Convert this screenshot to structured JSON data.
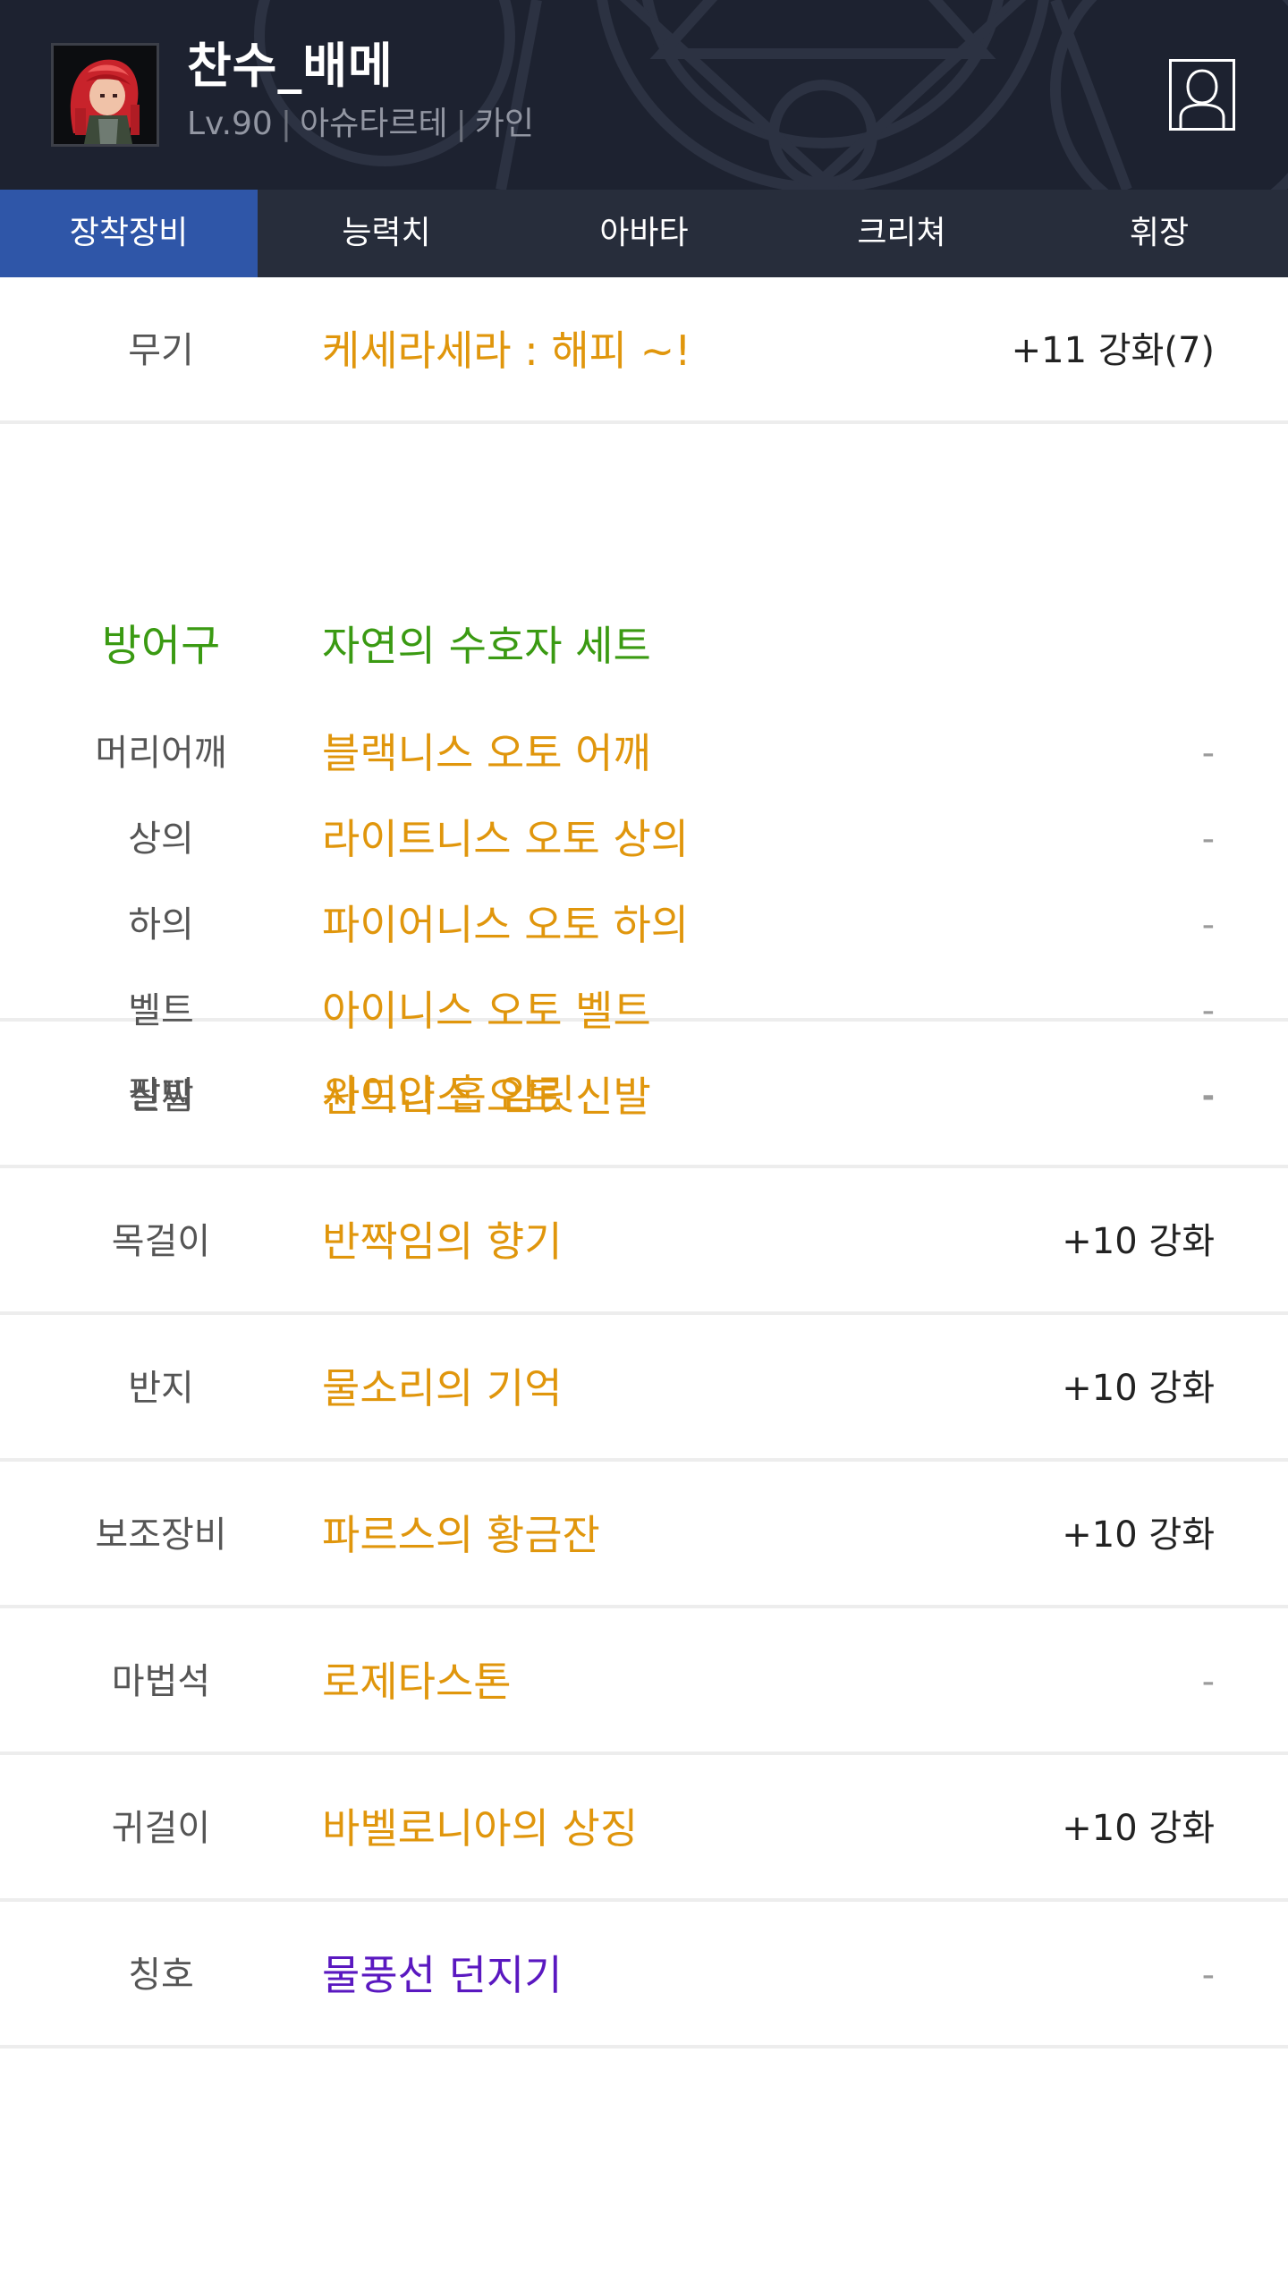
{
  "profile": {
    "name": "찬수_배메",
    "level": "Lv.90",
    "job": "아슈타르테",
    "server": "카인",
    "avatar_icon": "character-avatar-icon",
    "profile_icon": "person-profile-icon"
  },
  "tabs": [
    {
      "label": "장착장비",
      "active": true
    },
    {
      "label": "능력치",
      "active": false
    },
    {
      "label": "아바타",
      "active": false
    },
    {
      "label": "크리쳐",
      "active": false
    },
    {
      "label": "휘장",
      "active": false
    }
  ],
  "weapon": {
    "slot": "무기",
    "name": "케세라세라 : 해피 ~!",
    "enhance": "+11 강화(7)"
  },
  "armor": {
    "slot": "방어구",
    "set_name": "자연의 수호자 세트",
    "items": [
      {
        "slot": "머리어깨",
        "name": "블랙니스 오토 어깨",
        "enhance": "-"
      },
      {
        "slot": "상의",
        "name": "라이트니스 오토 상의",
        "enhance": "-"
      },
      {
        "slot": "하의",
        "name": "파이어니스 오토 하의",
        "enhance": "-"
      },
      {
        "slot": "벨트",
        "name": "아이니스 오토 벨트",
        "enhance": "-"
      },
      {
        "slot": "신발",
        "name": "윈드니스 오토 신발",
        "enhance": "-"
      }
    ]
  },
  "accessories": [
    {
      "slot": "팔찌",
      "name": "사이얀 홉 암릿",
      "enhance": "-"
    },
    {
      "slot": "목걸이",
      "name": "반짝임의 향기",
      "enhance": "+10 강화"
    },
    {
      "slot": "반지",
      "name": "물소리의 기억",
      "enhance": "+10 강화"
    },
    {
      "slot": "보조장비",
      "name": "파르스의 황금잔",
      "enhance": "+10 강화"
    },
    {
      "slot": "마법석",
      "name": "로제타스톤",
      "enhance": "-"
    },
    {
      "slot": "귀걸이",
      "name": "바벨로니아의 상징",
      "enhance": "+10 강화"
    },
    {
      "slot": "칭호",
      "name": "물풍선 던지기",
      "enhance": "-"
    }
  ],
  "colors": {
    "header_bg": "#1d2230",
    "tab_bar_bg": "#272d3b",
    "tab_active_bg": "#2f56a8",
    "unique_item": "#e0960c",
    "set_item": "#3a9a12",
    "title_item": "#5a18c0"
  }
}
